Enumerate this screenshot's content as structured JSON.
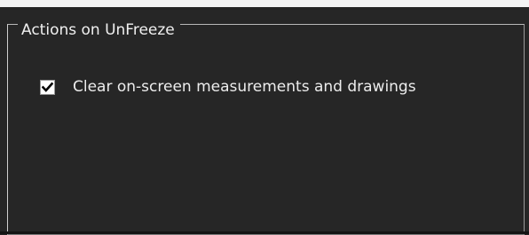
{
  "group": {
    "title": "Actions on UnFreeze"
  },
  "option": {
    "label": "Clear on-screen measurements and drawings",
    "checked": true,
    "icon": "checkmark-icon"
  }
}
